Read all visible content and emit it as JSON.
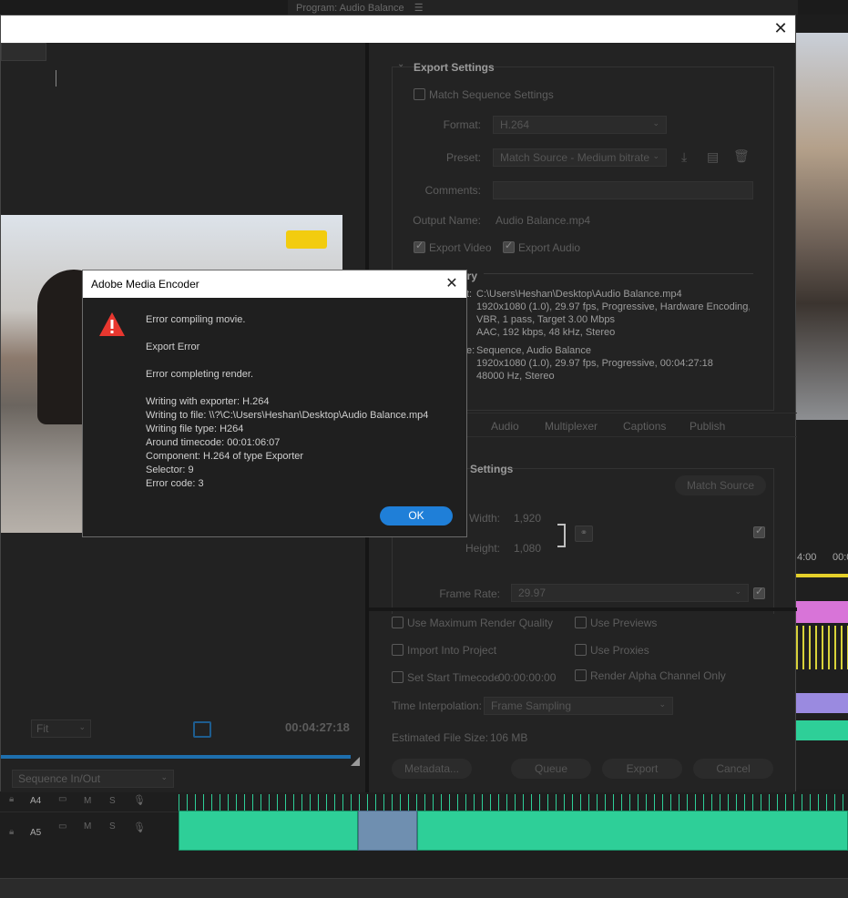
{
  "program_panel": {
    "title": "Program: Audio Balance"
  },
  "export_settings": {
    "heading": "Export Settings",
    "match_sequence_label": "Match Sequence Settings",
    "format_label": "Format:",
    "format_value": "H.264",
    "preset_label": "Preset:",
    "preset_value": "Match Source - Medium bitrate",
    "comments_label": "Comments:",
    "output_name_label": "Output Name:",
    "output_name_value": "Audio Balance.mp4",
    "export_video_label": "Export Video",
    "export_audio_label": "Export Audio",
    "summary_heading": "ary",
    "summary_output_prefix": "t:",
    "summary_output_lines": [
      "C:\\Users\\Heshan\\Desktop\\Audio Balance.mp4",
      "1920x1080 (1.0), 29.97 fps, Progressive, Hardware Encoding,...",
      "VBR, 1 pass, Target 3.00 Mbps",
      "AAC, 192 kbps, 48 kHz, Stereo"
    ],
    "summary_source_prefix": "e:",
    "summary_source_lines": [
      "Sequence, Audio Balance",
      "1920x1080 (1.0), 29.97 fps, Progressive, 00:04:27:18",
      "48000 Hz, Stereo"
    ],
    "tabs": [
      "Audio",
      "Multiplexer",
      "Captions",
      "Publish"
    ],
    "video_settings_heading": "Settings",
    "match_source_button": "Match Source",
    "width_label": "Width:",
    "width_value": "1,920",
    "height_label": "Height:",
    "height_value": "1,080",
    "frame_rate_label": "Frame Rate:",
    "frame_rate_value": "29.97"
  },
  "bottom_options": {
    "max_render_quality": "Use Maximum Render Quality",
    "use_previews": "Use Previews",
    "import_into_project": "Import Into Project",
    "use_proxies": "Use Proxies",
    "set_start_timecode": "Set Start Timecode",
    "start_timecode_value": "00:00:00:00",
    "render_alpha": "Render Alpha Channel Only",
    "time_interpolation_label": "Time Interpolation:",
    "time_interpolation_value": "Frame Sampling",
    "estimated_size_label": "Estimated File Size:",
    "estimated_size_value": "106 MB",
    "metadata_button": "Metadata...",
    "queue_button": "Queue",
    "export_button": "Export",
    "cancel_button": "Cancel"
  },
  "source_panel": {
    "fit_value": "Fit",
    "timecode": "00:04:27:18",
    "range_value": "Sequence In/Out",
    "playhead_fraction": 1.0
  },
  "timeline": {
    "track_a4": "A4",
    "track_a5": "A5",
    "mute_label": "M",
    "solo_label": "S",
    "ruler_times": [
      "4:00",
      "00:0"
    ]
  },
  "error_dialog": {
    "title": "Adobe Media Encoder",
    "line1": "Error compiling movie.",
    "line2": "Export Error",
    "line3": "Error completing render.",
    "details": [
      "Writing with exporter: H.264",
      "Writing to file: \\\\?\\C:\\Users\\Heshan\\Desktop\\Audio Balance.mp4",
      "Writing file type: H264",
      "Around timecode: 00:01:06:07",
      "Component: H.264 of type Exporter",
      "Selector: 9",
      "Error code: 3"
    ],
    "ok_button": "OK"
  },
  "colors": {
    "ok_blue": "#1f7fd8",
    "scrub_blue": "#1e6fae",
    "audio_green": "#2ecf98",
    "warning_red": "#e8372f"
  }
}
